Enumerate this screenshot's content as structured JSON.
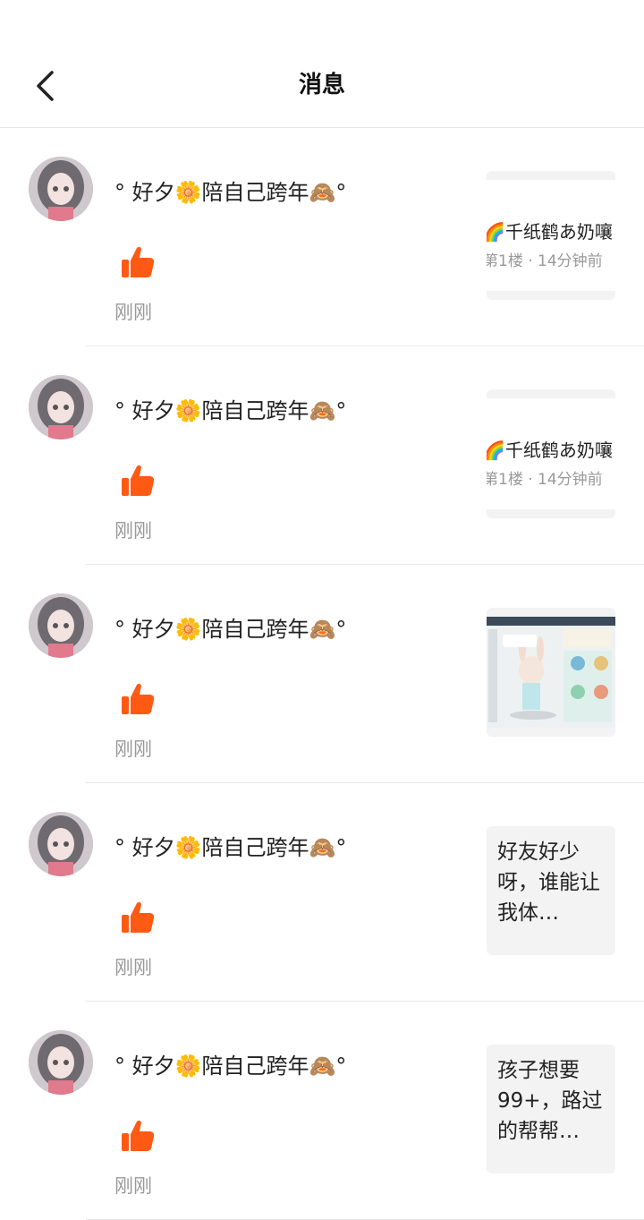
{
  "header": {
    "title": "消息",
    "back_icon": "chevron-left-icon"
  },
  "colors": {
    "like": "#ff5a14",
    "time": "#999999",
    "ref_bg": "#f3f3f3"
  },
  "messages": [
    {
      "username": "°  好夕🌼陪自己跨年🙈°",
      "action_icon": "thumbs-up-icon",
      "time": "刚刚",
      "ref_type": "card",
      "ref_name": "🌈千纸鹤あ奶嚷",
      "ref_meta": "第1楼 · 14分钟前"
    },
    {
      "username": "°  好夕🌼陪自己跨年🙈°",
      "action_icon": "thumbs-up-icon",
      "time": "刚刚",
      "ref_type": "card",
      "ref_name": "🌈千纸鹤あ奶嚷",
      "ref_meta": "第1楼 · 14分钟前"
    },
    {
      "username": "°  好夕🌼陪自己跨年🙈°",
      "action_icon": "thumbs-up-icon",
      "time": "刚刚",
      "ref_type": "image",
      "ref_image": "game-screenshot-thumbnail"
    },
    {
      "username": "°  好夕🌼陪自己跨年🙈°",
      "action_icon": "thumbs-up-icon",
      "time": "刚刚",
      "ref_type": "text",
      "ref_text": "好友好少呀，谁能让我体…"
    },
    {
      "username": "°  好夕🌼陪自己跨年🙈°",
      "action_icon": "thumbs-up-icon",
      "time": "刚刚",
      "ref_type": "text",
      "ref_text": "孩子想要99+，路过的帮帮…"
    }
  ]
}
